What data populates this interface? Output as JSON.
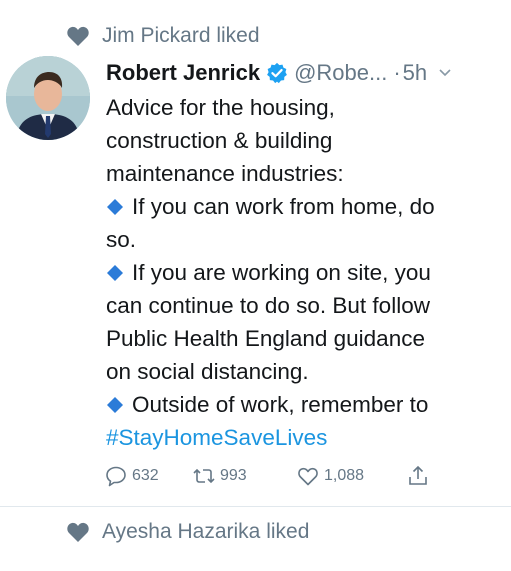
{
  "social_context": {
    "text": "Jim Pickard liked"
  },
  "tweet": {
    "author_name": "Robert Jenrick",
    "handle": "@Robe...",
    "separator": "·",
    "time": "5h",
    "lines": [
      "Advice for the housing,",
      "construction & building",
      "maintenance industries:",
      "If you can work from home, do",
      "so.",
      "If you are working on site, you",
      "can continue to do so. But follow",
      "Public Health England guidance",
      "on social distancing.",
      "Outside of work, remember to",
      "#StayHomeSaveLives"
    ],
    "replies": "632",
    "retweets": "993",
    "likes": "1,088"
  },
  "next_context": {
    "text": "Ayesha Hazarika liked"
  },
  "colors": {
    "accent": "#1b95e0",
    "diamond": "#2b7bd8",
    "muted": "#657786"
  },
  "icons": [
    "heart-icon",
    "verified-badge-icon",
    "chevron-down-icon",
    "diamond-icon",
    "reply-icon",
    "retweet-icon",
    "like-icon",
    "share-icon"
  ]
}
